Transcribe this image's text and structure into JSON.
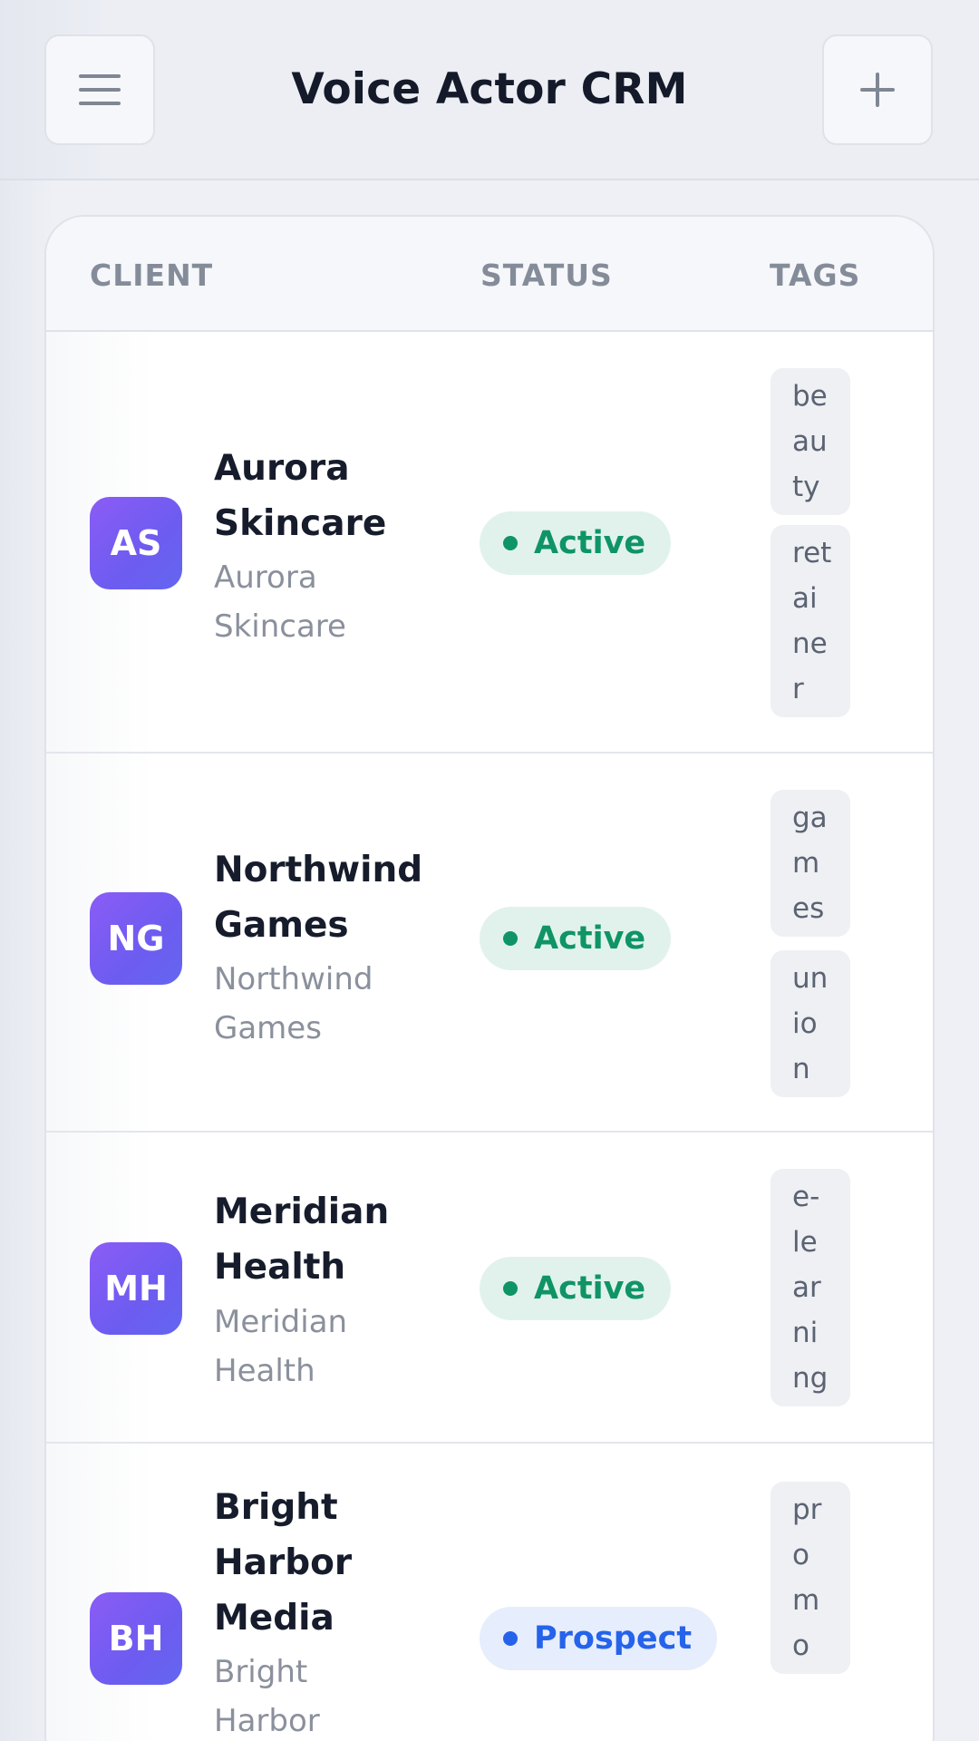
{
  "header": {
    "title": "Voice Actor CRM",
    "menu_icon": "menu-icon",
    "add_icon": "plus-icon"
  },
  "table": {
    "columns": [
      "CLIENT",
      "STATUS",
      "TAGS"
    ],
    "rows": [
      {
        "initials": "AS",
        "name_lines": [
          "Aurora",
          "Skincare"
        ],
        "company_lines": [
          "Aurora",
          "Skincare"
        ],
        "status": "Active",
        "tags": [
          {
            "text": "beauty",
            "lines": [
              "be",
              "au",
              "ty"
            ]
          },
          {
            "text": "retainer",
            "lines": [
              "ret",
              "ai",
              "ne",
              "r"
            ]
          }
        ]
      },
      {
        "initials": "NG",
        "name_lines": [
          "Northwind",
          "Games"
        ],
        "company_lines": [
          "Northwind",
          "Games"
        ],
        "status": "Active",
        "tags": [
          {
            "text": "games",
            "lines": [
              "ga",
              "m",
              "es"
            ]
          },
          {
            "text": "union",
            "lines": [
              "un",
              "io",
              "n"
            ]
          }
        ]
      },
      {
        "initials": "MH",
        "name_lines": [
          "Meridian",
          "Health"
        ],
        "company_lines": [
          "Meridian",
          "Health"
        ],
        "status": "Active",
        "tags": [
          {
            "text": "e-learning",
            "lines": [
              "e-",
              "le",
              "ar",
              "ni",
              "ng"
            ]
          }
        ]
      },
      {
        "initials": "BH",
        "name_lines": [
          "Bright",
          "Harbor",
          "Media"
        ],
        "company_lines": [
          "Bright",
          "Harbor"
        ],
        "status": "Prospect",
        "tags": [
          {
            "text": "promo",
            "lines": [
              "pr",
              "o",
              "m",
              "o"
            ]
          }
        ]
      }
    ]
  },
  "colors": {
    "active_text": "#0f9466",
    "active_bg": "#e1f2ec",
    "prospect_text": "#2563eb",
    "prospect_bg": "#e6edfc",
    "avatar_gradient_start": "#8b5cf6",
    "avatar_gradient_end": "#6366f1"
  }
}
